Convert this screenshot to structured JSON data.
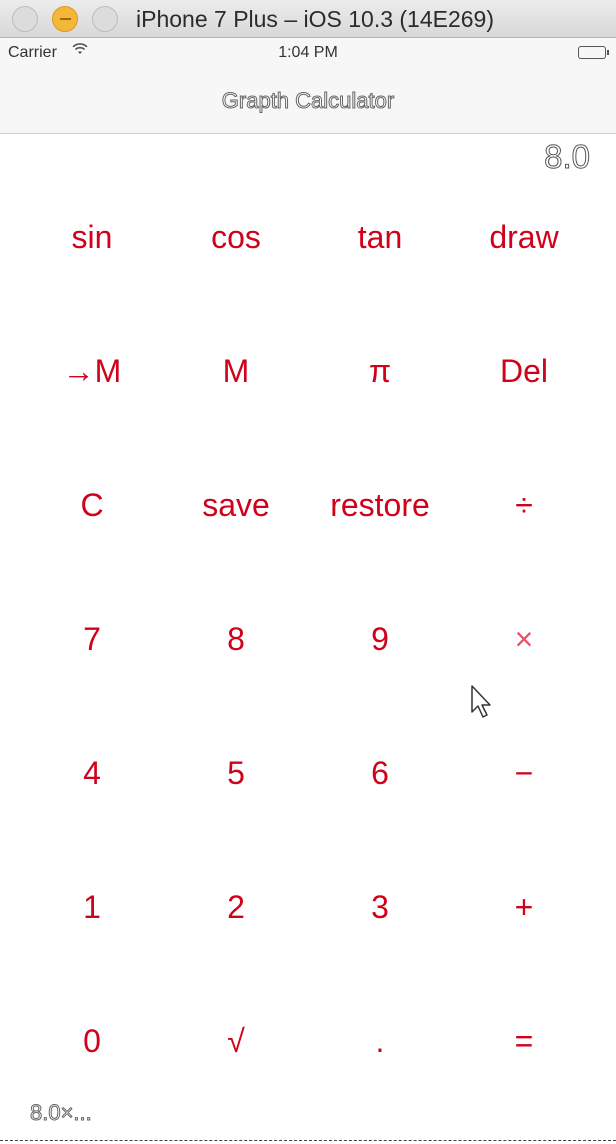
{
  "window": {
    "title": "iPhone 7 Plus – iOS 10.3 (14E269)"
  },
  "statusbar": {
    "carrier": "Carrier",
    "time": "1:04 PM"
  },
  "navbar": {
    "title": "Grapth Calculator"
  },
  "display": {
    "value": "8.0"
  },
  "history": {
    "text": "8.0×..."
  },
  "keypad": {
    "rows": [
      [
        "sin",
        "cos",
        "tan",
        "draw"
      ],
      [
        "→M",
        "M",
        "π",
        "Del"
      ],
      [
        "C",
        "save",
        "restore",
        "÷"
      ],
      [
        "7",
        "8",
        "9",
        "×"
      ],
      [
        "4",
        "5",
        "6",
        "−"
      ],
      [
        "1",
        "2",
        "3",
        "+"
      ],
      [
        "0",
        "√",
        ".",
        "="
      ]
    ]
  },
  "colors": {
    "key_text": "#d0021b",
    "key_highlight": "#e9536a"
  },
  "icons": {
    "wifi": "wifi-icon",
    "battery": "battery-icon",
    "cursor": "mouse-pointer-icon"
  }
}
